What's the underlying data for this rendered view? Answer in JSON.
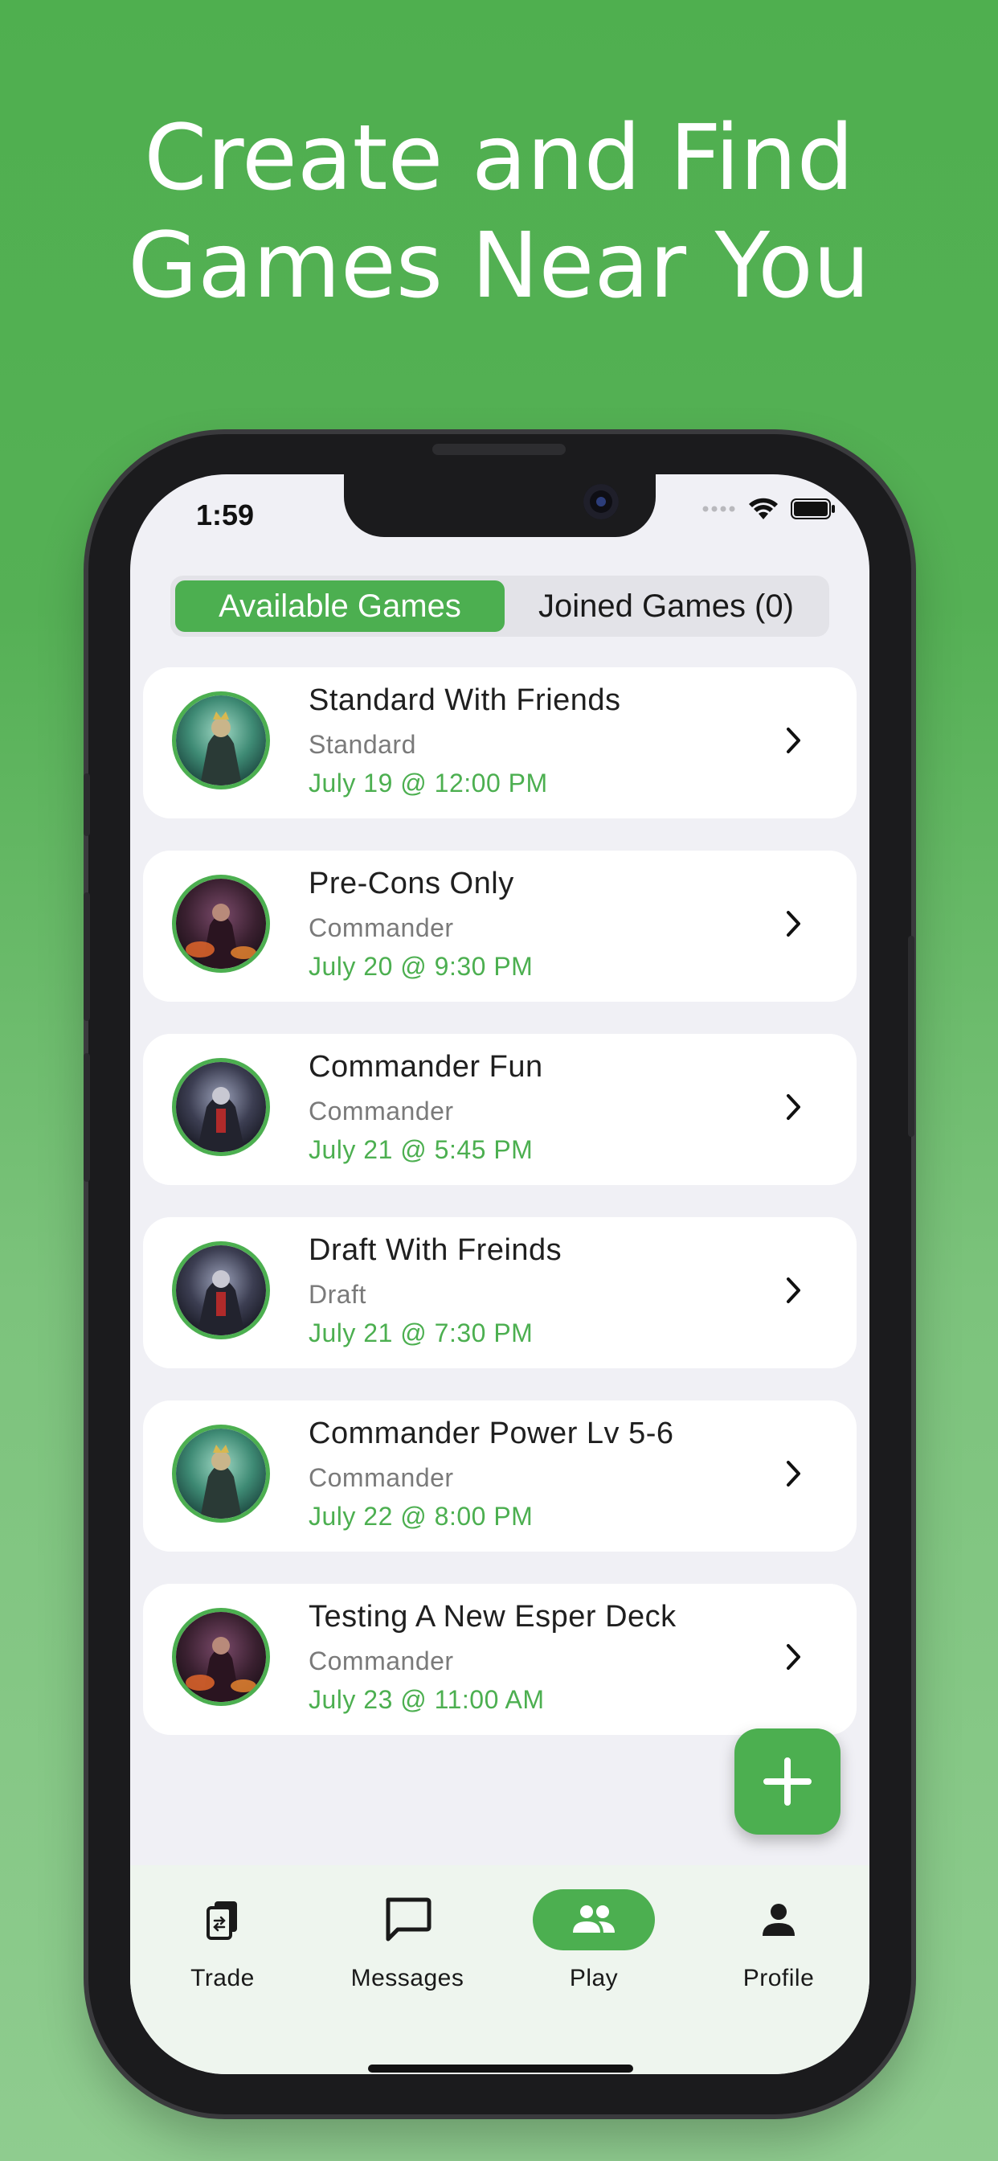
{
  "headline": {
    "line1": "Create and Find",
    "line2": "Games Near You"
  },
  "status_bar": {
    "time": "1:59"
  },
  "segments": {
    "available": "Available Games",
    "joined": "Joined Games (0)"
  },
  "games": [
    {
      "title": "Standard With Friends",
      "format": "Standard",
      "date": "July 19 @ 12:00 PM",
      "avatar": "art-green"
    },
    {
      "title": "Pre-Cons Only",
      "format": "Commander",
      "date": "July 20 @ 9:30 PM",
      "avatar": "art-fire"
    },
    {
      "title": "Commander Fun",
      "format": "Commander",
      "date": "July 21 @ 5:45 PM",
      "avatar": "art-dark"
    },
    {
      "title": "Draft With Freinds",
      "format": "Draft",
      "date": "July 21 @ 7:30 PM",
      "avatar": "art-dark"
    },
    {
      "title": "Commander Power Lv 5-6",
      "format": "Commander",
      "date": "July 22 @ 8:00 PM",
      "avatar": "art-green"
    },
    {
      "title": "Testing A New Esper Deck",
      "format": "Commander",
      "date": "July 23 @ 11:00 AM",
      "avatar": "art-fire"
    }
  ],
  "tabs": [
    {
      "label": "Trade",
      "icon": "trade-cards-icon",
      "active": false
    },
    {
      "label": "Messages",
      "icon": "chat-bubble-icon",
      "active": false
    },
    {
      "label": "Play",
      "icon": "people-icon",
      "active": true
    },
    {
      "label": "Profile",
      "icon": "person-icon",
      "active": false
    }
  ],
  "colors": {
    "accent": "#4caf50",
    "background_top": "#4faf4f",
    "tabbar": "#eef5ee"
  }
}
